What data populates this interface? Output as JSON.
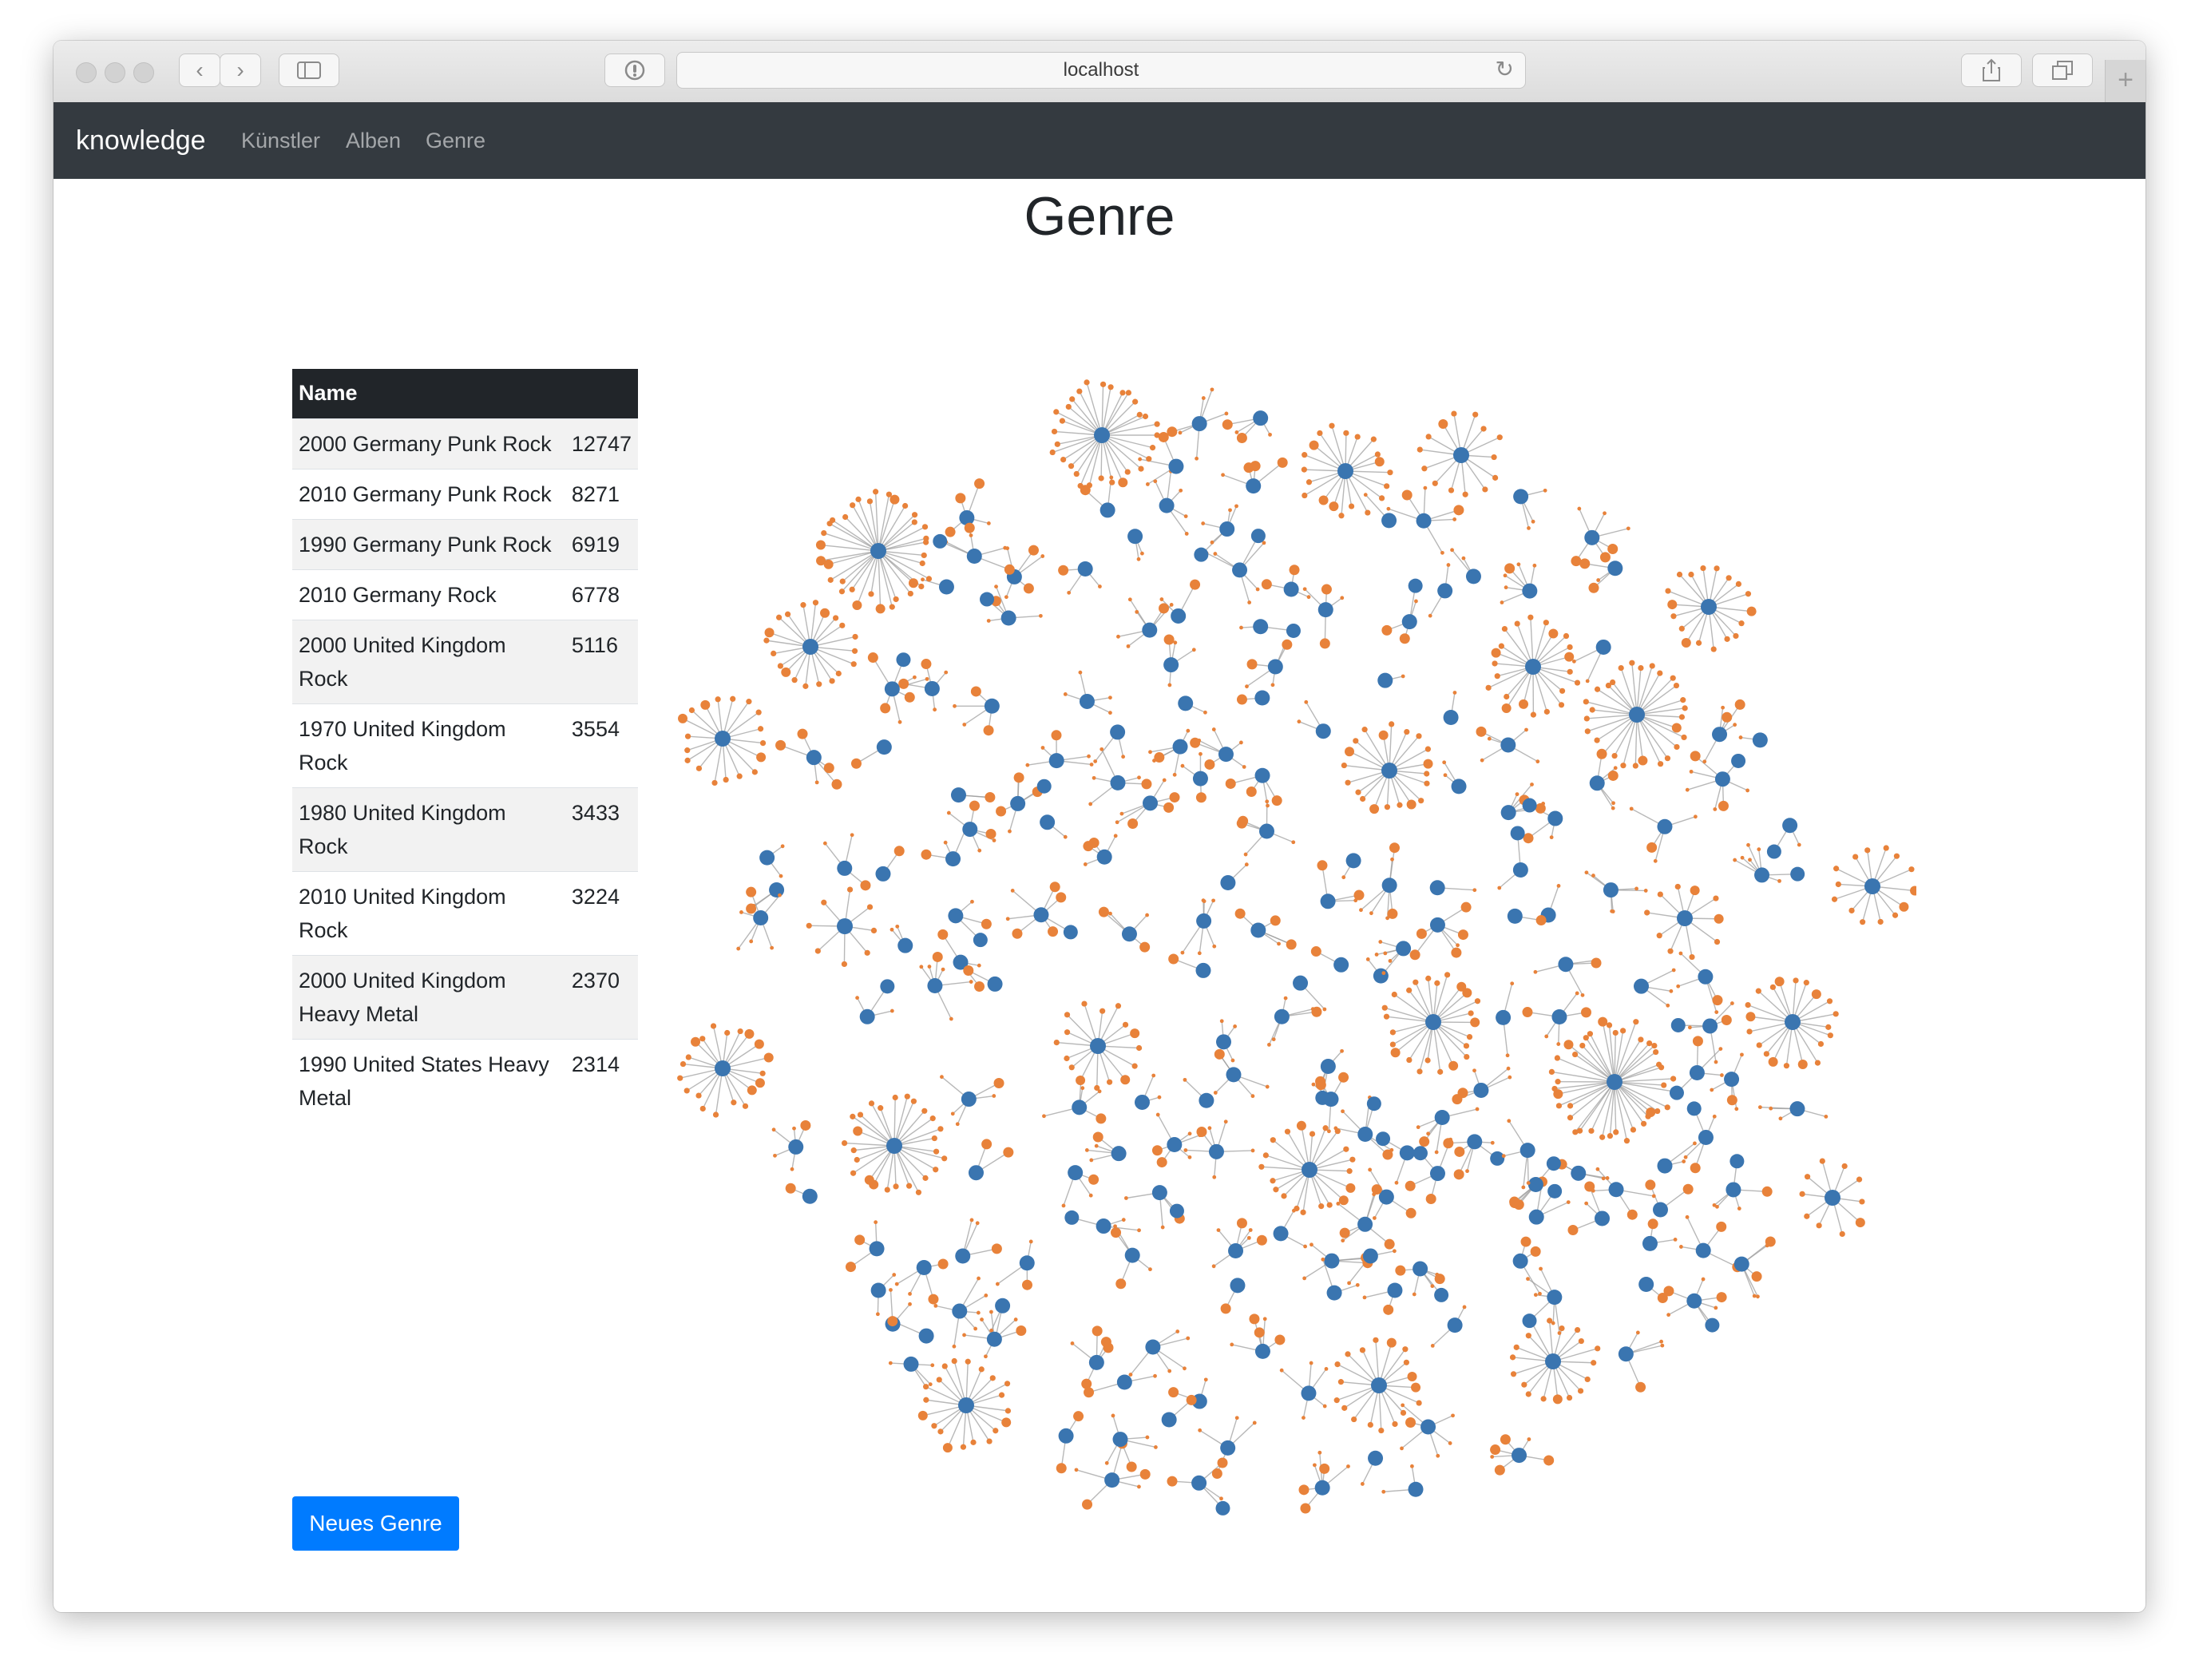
{
  "browser": {
    "url": "localhost"
  },
  "navbar": {
    "brand": "knowledge",
    "links": [
      "Künstler",
      "Alben",
      "Genre"
    ]
  },
  "page": {
    "title": "Genre"
  },
  "table": {
    "header": "Name",
    "rows": [
      {
        "name": "2000 Germany Punk Rock",
        "count": "12747"
      },
      {
        "name": "2010 Germany Punk Rock",
        "count": "8271"
      },
      {
        "name": "1990 Germany Punk Rock",
        "count": "6919"
      },
      {
        "name": "2010 Germany Rock",
        "count": "6778"
      },
      {
        "name": "2000 United Kingdom Rock",
        "count": "5116"
      },
      {
        "name": "1970 United Kingdom Rock",
        "count": "3554"
      },
      {
        "name": "1980 United Kingdom Rock",
        "count": "3433"
      },
      {
        "name": "2010 United Kingdom Rock",
        "count": "3224"
      },
      {
        "name": "2000 United Kingdom Heavy Metal",
        "count": "2370"
      },
      {
        "name": "1990 United States Heavy Metal",
        "count": "2314"
      }
    ]
  },
  "actions": {
    "new_genre": "Neues Genre"
  },
  "graph": {
    "colors": {
      "genre_node": "#3a75b0",
      "leaf_node": "#e8823a",
      "link": "#9a9a9a"
    }
  }
}
